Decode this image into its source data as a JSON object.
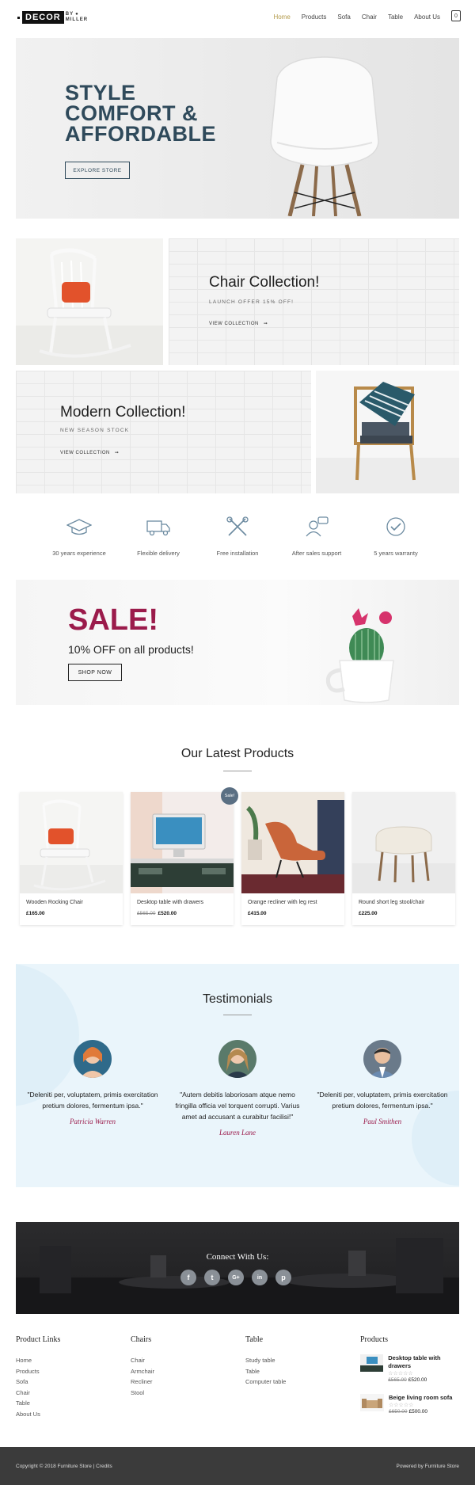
{
  "header": {
    "logo_main": "DECOR",
    "logo_by": "BY",
    "logo_sub": "MILLER",
    "nav": [
      "Home",
      "Products",
      "Sofa",
      "Chair",
      "Table",
      "About Us"
    ],
    "cart_count": "0"
  },
  "hero": {
    "title": "STYLE\nCOMFORT &\nAFFORDABLE",
    "button": "EXPLORE STORE"
  },
  "collections": [
    {
      "title": "Chair Collection!",
      "subtitle": "LAUNCH OFFER 15% OFF!",
      "link": "VIEW COLLECTION"
    },
    {
      "title": "Modern Collection!",
      "subtitle": "NEW SEASON STOCK",
      "link": "VIEW COLLECTION"
    }
  ],
  "features": [
    {
      "label": "30 years experience",
      "icon": "graduation-cap-icon"
    },
    {
      "label": "Flexible delivery",
      "icon": "delivery-truck-icon"
    },
    {
      "label": "Free installation",
      "icon": "tools-icon"
    },
    {
      "label": "After sales support",
      "icon": "support-agent-icon"
    },
    {
      "label": "5 years warranty",
      "icon": "warranty-shield-icon"
    }
  ],
  "sale": {
    "title": "SALE!",
    "subtitle": "10% OFF on all products!",
    "button": "SHOP NOW"
  },
  "latest": {
    "title": "Our Latest Products",
    "products": [
      {
        "name": "Wooden Rocking Chair",
        "old_price": "",
        "price": "£165.00",
        "badge": ""
      },
      {
        "name": "Desktop table with drawers",
        "old_price": "£565.00",
        "price": "£520.00",
        "badge": "Sale!"
      },
      {
        "name": "Orange recliner with leg rest",
        "old_price": "",
        "price": "£415.00",
        "badge": ""
      },
      {
        "name": "Round short leg stool/chair",
        "old_price": "",
        "price": "£225.00",
        "badge": ""
      }
    ]
  },
  "testimonials": {
    "title": "Testimonials",
    "items": [
      {
        "quote": "\"Deleniti per, voluptatem, primis exercitation pretium dolores, fermentum ipsa.\"",
        "author": "Patricia Warren"
      },
      {
        "quote": "\"Autem debitis laboriosam atque nemo fringilla officia vel torquent corrupti. Varius amet ad accusant a curabitur facilisi!\"",
        "author": "Lauren Lane"
      },
      {
        "quote": "\"Deleniti per, voluptatem, primis exercitation pretium dolores, fermentum ipsa.\"",
        "author": "Paul Smithen"
      }
    ]
  },
  "connect": {
    "title": "Connect With Us:",
    "social": [
      {
        "glyph": "f",
        "icon": "facebook-icon"
      },
      {
        "glyph": "t",
        "icon": "twitter-icon"
      },
      {
        "glyph": "G+",
        "icon": "google-plus-icon"
      },
      {
        "glyph": "in",
        "icon": "linkedin-icon"
      },
      {
        "glyph": "p",
        "icon": "pinterest-icon"
      }
    ]
  },
  "footer": {
    "product_links": {
      "heading": "Product Links",
      "items": [
        "Home",
        "Products",
        "Sofa",
        "Chair",
        "Table",
        "About Us"
      ]
    },
    "chairs": {
      "heading": "Chairs",
      "items": [
        "Chair",
        "Armchair",
        "Recliner",
        "Stool"
      ]
    },
    "table": {
      "heading": "Table",
      "items": [
        "Study table",
        "Table",
        "Computer table"
      ]
    },
    "products": {
      "heading": "Products",
      "items": [
        {
          "title": "Desktop table with drawers",
          "stars": "☆☆☆☆☆",
          "old_price": "£565.00",
          "price": "£520.00"
        },
        {
          "title": "Beige living room sofa",
          "stars": "☆☆☆☆☆",
          "old_price": "£650.00",
          "price": "£500.00"
        }
      ]
    },
    "copyright": "Copyright © 2018 Furniture Store | Credits",
    "powered": "Powered by Furniture Store"
  },
  "colors": {
    "accent": "#2f4a5b",
    "sale": "#9b1b4b",
    "nav_active": "#b39a4a",
    "testimonial_bg": "#eaf5fb",
    "footer_bar": "#3b3b3b"
  }
}
